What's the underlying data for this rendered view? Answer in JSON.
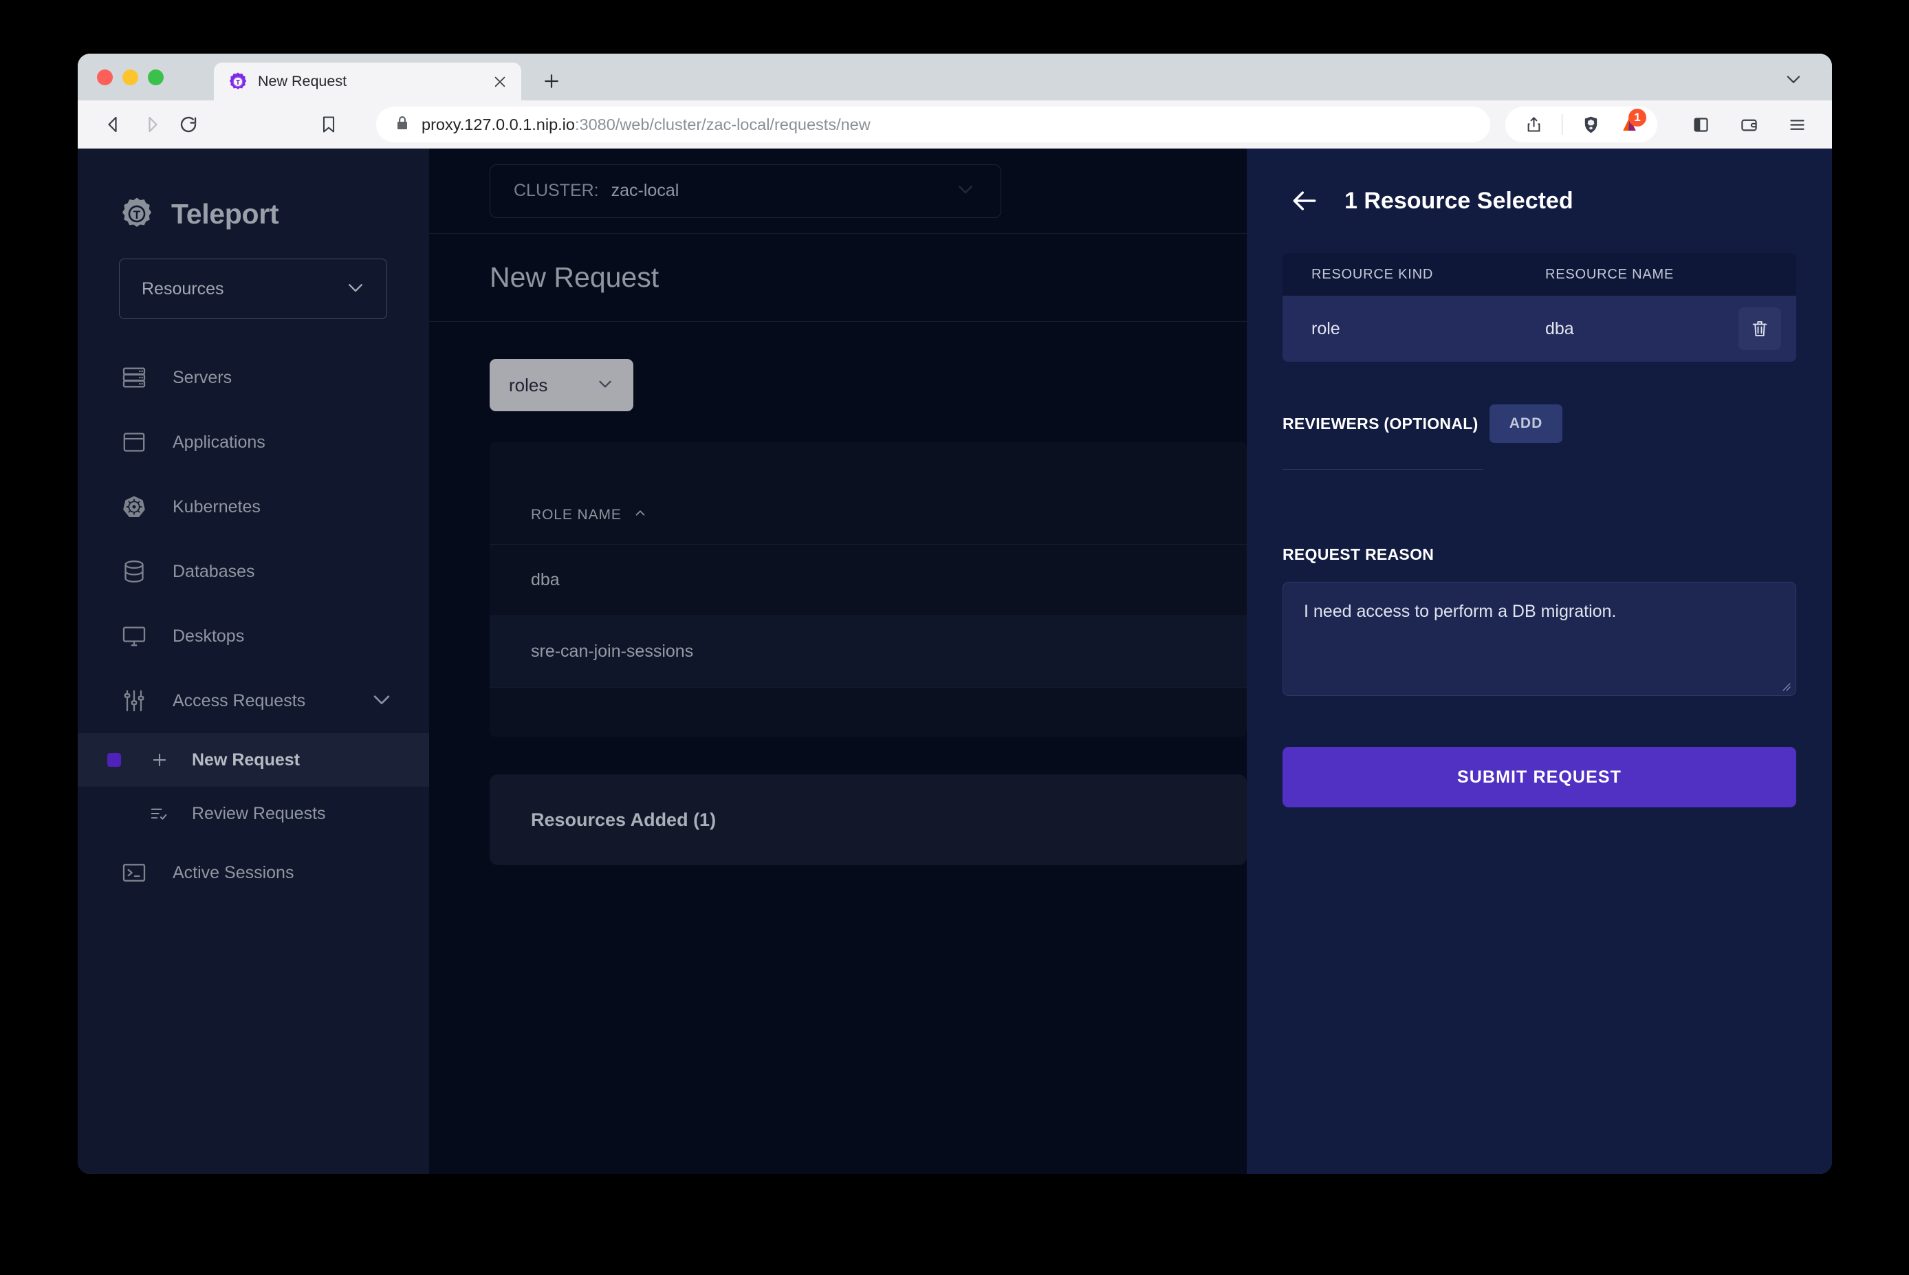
{
  "browser": {
    "tab": {
      "title": "New Request",
      "favicon_icon": "teleport-gear-favicon",
      "close_icon": "close-icon"
    },
    "new_tab_icon": "plus-icon",
    "window_chevron_icon": "chevron-down-icon",
    "nav": {
      "back_icon": "back-arrow-icon",
      "forward_icon": "forward-arrow-icon",
      "reload_icon": "reload-icon",
      "bookmark_icon": "bookmark-icon"
    },
    "url": {
      "lock_icon": "lock-icon",
      "host": "proxy.127.0.0.1.nip.io",
      "path": ":3080/web/cluster/zac-local/requests/new",
      "full": "proxy.127.0.0.1.nip.io:3080/web/cluster/zac-local/requests/new"
    },
    "tools": {
      "share_icon": "share-icon",
      "shield_icon": "brave-shield-icon",
      "rewards_icon": "brave-rewards-icon",
      "rewards_badge": "1",
      "sidebar_icon": "sidebar-panel-icon",
      "wallet_icon": "wallet-icon",
      "menu_icon": "hamburger-menu-icon"
    }
  },
  "sidebar": {
    "brand": {
      "name": "Teleport",
      "logo_icon": "teleport-gear-logo"
    },
    "cluster_selector": {
      "label": "Resources",
      "chevron_icon": "chevron-down-icon"
    },
    "nav_items": [
      {
        "label": "Servers",
        "icon": "server-rack-icon"
      },
      {
        "label": "Applications",
        "icon": "application-window-icon"
      },
      {
        "label": "Kubernetes",
        "icon": "kubernetes-helm-icon"
      },
      {
        "label": "Databases",
        "icon": "database-cylinder-icon"
      },
      {
        "label": "Desktops",
        "icon": "desktop-monitor-icon"
      },
      {
        "label": "Access Requests",
        "icon": "sliders-icon",
        "chevron_icon": "chevron-down-icon",
        "expanded": true
      }
    ],
    "sub_items": [
      {
        "label": "New Request",
        "icon": "plus-icon",
        "active": true
      },
      {
        "label": "Review Requests",
        "icon": "list-check-icon",
        "active": false
      }
    ],
    "trailing_items": [
      {
        "label": "Active Sessions",
        "icon": "terminal-icon"
      }
    ]
  },
  "main": {
    "cluster_bar": {
      "prefix": "CLUSTER:",
      "cluster_name": "zac-local",
      "chevron_icon": "chevron-down-icon"
    },
    "page_title": "New Request",
    "kind_filter": {
      "value": "roles",
      "chevron_icon": "chevron-down-icon"
    },
    "roles_table": {
      "columns": [
        "ROLE NAME"
      ],
      "sort_icon": "caret-up-icon",
      "rows": [
        {
          "role_name": "dba"
        },
        {
          "role_name": "sre-can-join-sessions"
        }
      ]
    },
    "resources_added_label": "Resources Added (1)"
  },
  "drawer": {
    "back_icon": "back-arrow-icon",
    "title": "1 Resource Selected",
    "resource_table": {
      "columns": [
        "RESOURCE KIND",
        "RESOURCE NAME"
      ],
      "rows": [
        {
          "kind": "role",
          "name": "dba",
          "delete_icon": "trash-icon"
        }
      ]
    },
    "reviewers": {
      "label": "REVIEWERS (OPTIONAL)",
      "add_label": "ADD"
    },
    "reason": {
      "label": "REQUEST REASON",
      "value": "I need access to perform a DB migration."
    },
    "submit_label": "SUBMIT REQUEST"
  },
  "colors": {
    "accent_purple": "#5130C4",
    "active_indicator": "#4F22BA",
    "sidebar_bg": "#11172C",
    "main_bg": "#060B1C",
    "drawer_bg": "#121B40",
    "badge_orange": "#FB542B"
  }
}
